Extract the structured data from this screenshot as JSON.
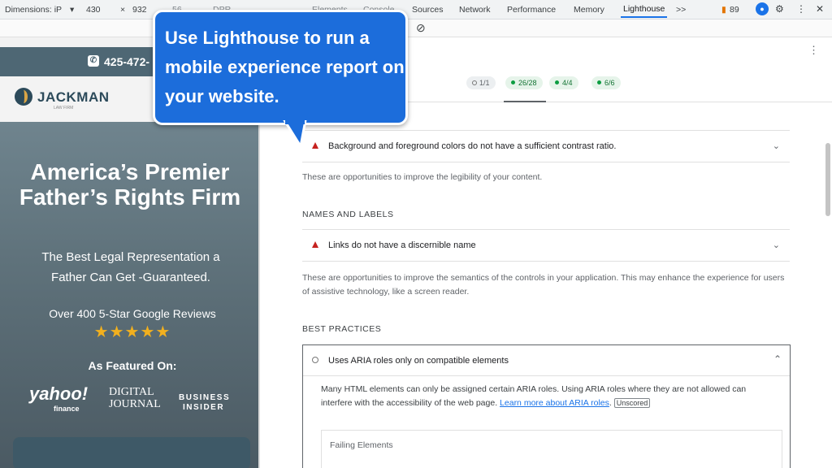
{
  "devtools": {
    "dimensions_label": "Dimensions: iP",
    "width": "430",
    "height": "932",
    "zoom": "56",
    "dpr": "DPR",
    "tabs": [
      "Elements",
      "Console",
      "Sources",
      "Network",
      "Performance",
      "Memory",
      "Lighthouse"
    ],
    "active_tab": "Lighthouse",
    "more_tabs": ">>",
    "issues_count": "89"
  },
  "site": {
    "phone": "425-472-",
    "logo_name": "JACKMAN",
    "logo_sub": "LAW FIRM",
    "headline": "America’s Premier Father’s Rights Firm",
    "subhead": "The Best Legal Representation a Father Can Get -Guaranteed.",
    "reviews": "Over 400 5-Star Google Reviews",
    "stars": "★★★★★",
    "featured": "As Featured On:",
    "press": [
      "yahoo!",
      "finance",
      "DIGITAL",
      "JOURNAL",
      "BUSINESS",
      "INSIDER"
    ],
    "star_color": "#f2b01e"
  },
  "lighthouse": {
    "scores": [
      "1/1",
      "26/28",
      "4/4",
      "6/6"
    ],
    "audit_contrast": "Background and foreground colors do not have a sufficient contrast ratio.",
    "contrast_desc": "These are opportunities to improve the legibility of your content.",
    "section_names": "NAMES AND LABELS",
    "audit_links": "Links do not have a discernible name",
    "names_desc": "These are opportunities to improve the semantics of the controls in your application. This may enhance the experience for users of assistive technology, like a screen reader.",
    "section_best": "BEST PRACTICES",
    "audit_aria": "Uses ARIA roles only on compatible elements",
    "aria_desc": "Many HTML elements can only be assigned certain ARIA roles. Using ARIA roles where they are not allowed can interfere with the accessibility of the web page.",
    "aria_link": "Learn more about ARIA roles",
    "unscored": "Unscored",
    "failing": "Failing Elements"
  },
  "callout": {
    "text": "Use Lighthouse to run a mobile experience report on your website."
  },
  "colors": {
    "accent": "#1c6ddb",
    "fail": "#c5221f",
    "pass": "#0c9d41"
  }
}
